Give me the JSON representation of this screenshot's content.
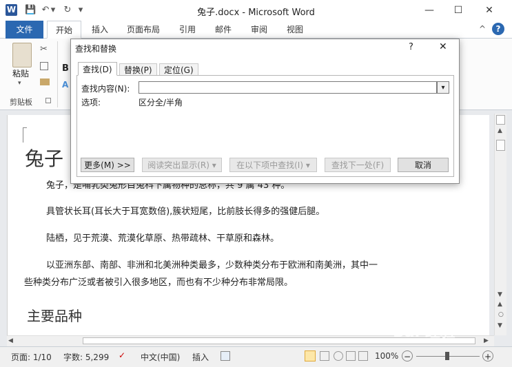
{
  "window": {
    "title": "兔子.docx - Microsoft Word",
    "app_icon": "W",
    "minimize": "—",
    "maximize": "☐",
    "close": "✕"
  },
  "qat": {
    "save": "💾",
    "undo": "↶",
    "undo_dd": "▾",
    "redo": "↻",
    "customize": "▾"
  },
  "ribbon": {
    "tabs": [
      "文件",
      "开始",
      "插入",
      "页面布局",
      "引用",
      "邮件",
      "审阅",
      "视图"
    ],
    "help": "?",
    "collapse": "^",
    "clipboard": {
      "paste_label": "粘贴",
      "group_label": "剪贴板",
      "bold": "B"
    }
  },
  "dialog": {
    "title": "查找和替换",
    "help": "?",
    "close": "✕",
    "tabs": [
      "查找(D)",
      "替换(P)",
      "定位(G)"
    ],
    "find_label": "查找内容(N):",
    "find_value": "",
    "options_label": "选项:",
    "options_value": "区分全/半角",
    "buttons": {
      "more": "更多(M) >>",
      "reading_highlight": "阅读突出显示(R) ▾",
      "find_in": "在以下项中查找(I) ▾",
      "find_next": "查找下一处(F)",
      "cancel": "取消"
    }
  },
  "document": {
    "heading": "兔子",
    "p1": "兔子，是哺乳类兔形目兔科下属物种的总称，共 9 属 43 种。",
    "p2": "具管状长耳(耳长大于耳宽数倍),簇状短尾，比前肢长得多的强健后腿。",
    "p3": "陆栖，见于荒漠、荒漠化草原、热带疏林、干草原和森林。",
    "p4a": "以亚洲东部、南部、非洲和北美洲种类最多，少数种类分布于欧洲和南美洲，其中一",
    "p4b": "些种类分布广泛或者被引入很多地区，而也有不少种分布非常局限。",
    "h2": "主要品种"
  },
  "status": {
    "page": "页面: 1/10",
    "words": "字数: 5,299",
    "language": "中文(中国)",
    "mode": "插入",
    "zoom": "100%",
    "zoom_minus": "−",
    "zoom_plus": "+"
  },
  "watermark": "Bai 经验"
}
